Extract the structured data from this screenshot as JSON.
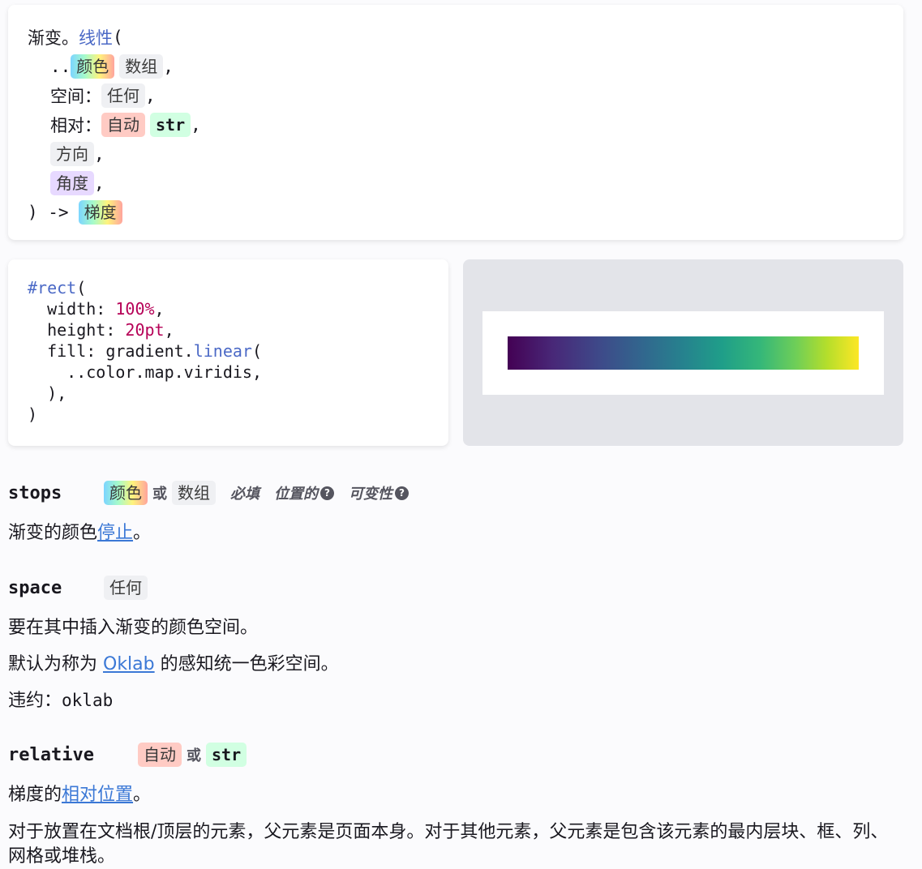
{
  "signature": {
    "fn_prefix": "渐变。",
    "fn_name": "线性",
    "open_paren": "(",
    "spread": "..",
    "stops_types": [
      "颜色",
      "数组"
    ],
    "space_label": "空间：",
    "space_type": "任何",
    "relative_label": "相对：",
    "relative_types": [
      "自动",
      "str"
    ],
    "dir_type": "方向",
    "angle_type": "角度",
    "comma": ",",
    "close": ") ->",
    "return_type": "梯度"
  },
  "example": {
    "lines": {
      "l1_kw": "#rect",
      "l1_rest": "(",
      "l2_key": "  width: ",
      "l2_val": "100%",
      "l2_end": ",",
      "l3_key": "  height: ",
      "l3_val": "20pt",
      "l3_end": ",",
      "l4_key": "  fill: gradient.",
      "l4_fn": "linear",
      "l4_end": "(",
      "l5": "    ..color.map.viridis,",
      "l6": "  ),",
      "l7": ")"
    },
    "preview_gradient": [
      "#440154",
      "#3e4989",
      "#26828e",
      "#35b779",
      "#fde725"
    ]
  },
  "params": {
    "stops": {
      "name": "stops",
      "types": [
        "颜色",
        "数组"
      ],
      "or": "或",
      "flags": [
        "必填",
        "位置的",
        "可变性"
      ],
      "desc_prefix": "渐变的颜色",
      "desc_link": "停止",
      "desc_suffix": "。"
    },
    "space": {
      "name": "space",
      "type": "任何",
      "desc1": "要在其中插入渐变的颜色空间。",
      "desc2_prefix": "默认为称为 ",
      "desc2_link": "Oklab",
      "desc2_suffix": " 的感知统一色彩空间。",
      "default_label": "违约：",
      "default_value": "oklab"
    },
    "relative": {
      "name": "relative",
      "types": [
        "自动",
        "str"
      ],
      "or": "或",
      "desc1_prefix": "梯度的",
      "desc1_link": "相对位置",
      "desc1_suffix": "。",
      "desc2": "对于放置在文档根/顶层的元素，父元素是页面本身。对于其他元素，父元素是包含该元素的最内层块、框、列、网格或堆栈。"
    }
  }
}
